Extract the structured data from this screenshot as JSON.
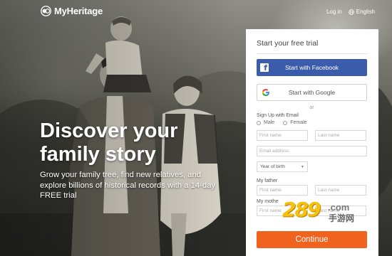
{
  "brand": {
    "name": "MyHeritage",
    "logo_icon": "myheritage-logo-icon"
  },
  "top_nav": {
    "login": "Log in",
    "language": "English",
    "language_icon": "globe-icon"
  },
  "hero": {
    "headline": "Discover your family story",
    "subtext": "Grow your family tree, find new relatives, and explore billions of historical records with a 14-day FREE trial"
  },
  "signup": {
    "title": "Start your free trial",
    "facebook_button": "Start with Facebook",
    "google_button": "Start with Google",
    "or": "or",
    "email_section": "Sign Up with Email",
    "gender_options": [
      "Male",
      "Female"
    ],
    "first_name_placeholder": "First name",
    "last_name_placeholder": "Last name",
    "email_placeholder": "Email address",
    "year_of_birth": "Year of birth",
    "father_label": "My father",
    "mother_label": "My mothe",
    "continue_button": "Continue"
  },
  "watermark": {
    "number": "289",
    "suffix": ".com",
    "cn": "手游网"
  },
  "colors": {
    "facebook": "#3b5bab",
    "continue": "#f0631f",
    "panel": "#ffffff"
  }
}
